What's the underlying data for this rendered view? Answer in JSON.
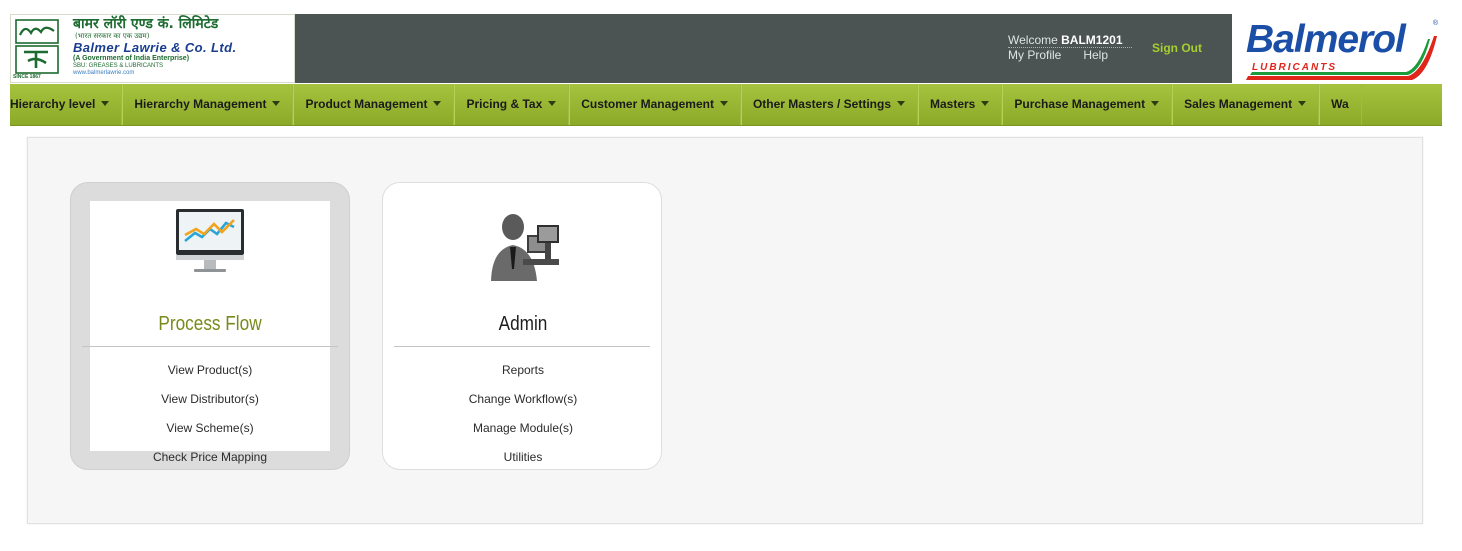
{
  "header": {
    "company_logo": {
      "hindi_name": "बामर लॉरी एण्ड कं. लिमिटेड",
      "hindi_sub": "(भारत सरकार का एक उद्यम)",
      "english_name": "Balmer Lawrie & Co. Ltd.",
      "govt_line": "(A Government of India Enterprise)",
      "sbu_line": "SBU: GREASES & LUBRICANTS",
      "website": "www.balmerlawrie.com",
      "since": "SINCE 1867"
    },
    "welcome_prefix": "Welcome",
    "username": "BALM1201",
    "my_profile_label": "My Profile",
    "help_label": "Help",
    "sign_out_label": "Sign Out",
    "brand_logo": {
      "name": "Balmerol",
      "tagline": "LUBRICANTS",
      "registered_mark": "®"
    },
    "colors": {
      "header_bg": "#4b5353",
      "sign_out": "#a5cf2e",
      "brand_blue": "#1b4fa7",
      "brand_red": "#e0251b"
    }
  },
  "navbar": {
    "items": [
      {
        "label": "Hierarchy level"
      },
      {
        "label": "Hierarchy Management"
      },
      {
        "label": "Product Management"
      },
      {
        "label": "Pricing & Tax"
      },
      {
        "label": "Customer Management"
      },
      {
        "label": "Other Masters / Settings"
      },
      {
        "label": "Masters"
      },
      {
        "label": "Purchase Management"
      },
      {
        "label": "Sales Management"
      },
      {
        "label": "Wa"
      }
    ],
    "caret_icon": "caret-down-icon",
    "color": "#9ab835"
  },
  "cards": [
    {
      "title": "Process Flow",
      "icon": "monitor-chart-icon",
      "links": [
        "View Product(s)",
        "View Distributor(s)",
        "View Scheme(s)",
        "Check Price Mapping"
      ],
      "active": true,
      "title_color": "#7a8a1c"
    },
    {
      "title": "Admin",
      "icon": "admin-user-computer-icon",
      "links": [
        "Reports",
        "Change Workflow(s)",
        "Manage Module(s)",
        "Utilities"
      ],
      "active": false,
      "title_color": "#1e1e1e"
    }
  ]
}
